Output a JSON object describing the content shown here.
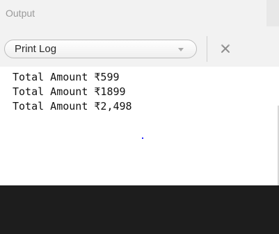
{
  "panel": {
    "title": "Output"
  },
  "toolbar": {
    "selected_log": "Print Log",
    "clear_icon": "clear-icon"
  },
  "console": {
    "lines": [
      "Total Amount ₹599",
      "Total Amount ₹1899",
      "Total Amount ₹2,498"
    ]
  },
  "colors": {
    "header_bg": "#f2f2f2",
    "console_bg": "#ffffff",
    "bottom_bg": "#1d1d1d"
  }
}
